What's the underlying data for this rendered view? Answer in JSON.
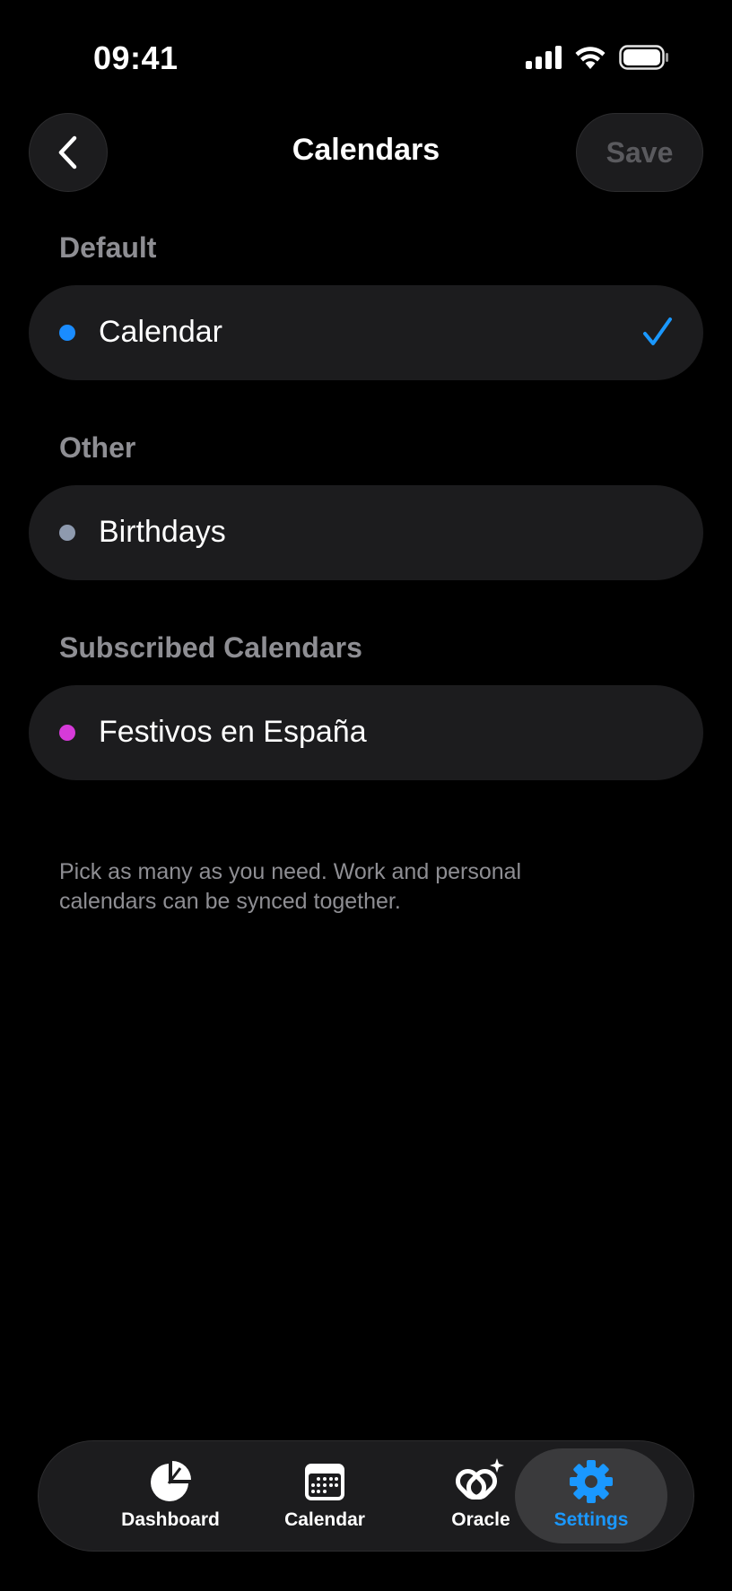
{
  "status_bar": {
    "time": "09:41"
  },
  "header": {
    "title": "Calendars",
    "save_label": "Save"
  },
  "sections": {
    "default": {
      "header": "Default",
      "items": [
        {
          "label": "Calendar",
          "color": "#1a8cff",
          "selected": true
        }
      ]
    },
    "other": {
      "header": "Other",
      "items": [
        {
          "label": "Birthdays",
          "color": "#8e9aae",
          "selected": false
        }
      ]
    },
    "subscribed": {
      "header": "Subscribed Calendars",
      "items": [
        {
          "label": "Festivos en España",
          "color": "#d63ad9",
          "selected": false
        }
      ]
    }
  },
  "footer_note": "Pick as many as you need. Work and personal calendars can be synced together.",
  "tab_bar": {
    "tabs": [
      {
        "label": "Dashboard",
        "icon": "pie-chart-icon",
        "active": false
      },
      {
        "label": "Calendar",
        "icon": "calendar-icon",
        "active": false
      },
      {
        "label": "Oracle",
        "icon": "oracle-sparkle-icon",
        "active": false
      },
      {
        "label": "Settings",
        "icon": "gear-icon",
        "active": true
      }
    ]
  },
  "colors": {
    "accent": "#1a98ff",
    "row_background": "#1c1c1e",
    "secondary_text": "#8e8e93"
  }
}
